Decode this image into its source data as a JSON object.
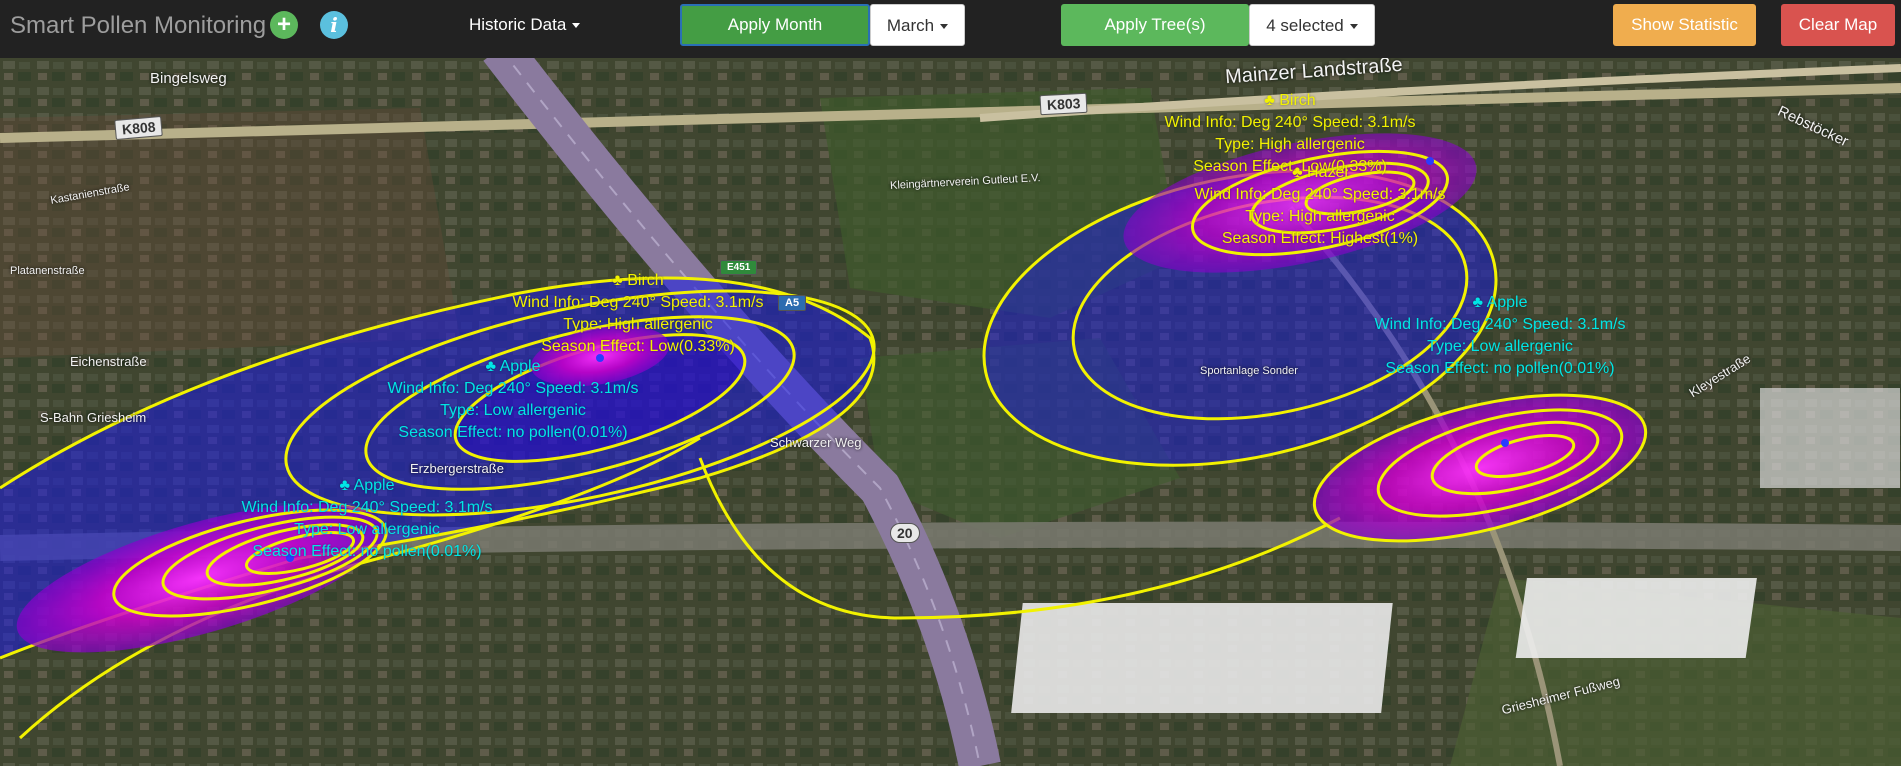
{
  "navbar": {
    "brand": "Smart Pollen Monitoring",
    "add_icon": "+",
    "info_icon": "i",
    "historic_label": "Historic Data",
    "apply_month_label": "Apply Month",
    "month_value": "March",
    "apply_trees_label": "Apply Tree(s)",
    "trees_value": "4 selected",
    "show_statistic_label": "Show Statistic",
    "clear_map_label": "Clear Map"
  },
  "colors": {
    "navbar_bg": "#222222",
    "green": "#5cb85c",
    "orange": "#f0ad4e",
    "red": "#d9534f",
    "contour": "#f2f200",
    "high_allergenic_text": "#f2f200",
    "low_allergenic_text": "#00e6e6"
  },
  "map": {
    "streets": {
      "bingelsweg": "Bingelsweg",
      "mainzer": "Mainzer Landstraße",
      "rebstoecker": "Rebstöcker",
      "eichenstrasse": "Eichenstraße",
      "erzberger": "Erzbergerstraße",
      "schwarzer": "Schwarzer Weg",
      "kleyestrasse": "Kleyestraße",
      "griesheimer": "Griesheimer Fußweg",
      "kleingarten": "Kleingärtnerverein Gutleut E.V.",
      "sportanlage": "Sportanlage Sonder",
      "sbahn": "S-Bahn Griesheim",
      "platanen": "Platanenstraße",
      "kastanien": "Kastanienstraße"
    },
    "road_signs": {
      "k808": "K808",
      "k803": "K803",
      "a5": "A5",
      "e451": "E451",
      "r20": "20"
    },
    "popups": {
      "birch_a": {
        "name": "♣ Birch",
        "wind": "Wind Info: Deg 240° Speed: 3.1m/s",
        "type": "Type: High allergenic",
        "season": "Season Effect: Low(0.33%)"
      },
      "apple_a": {
        "name": "♣ Apple",
        "wind": "Wind Info: Deg 240° Speed: 3.1m/s",
        "type": "Type: Low allergenic",
        "season": "Season Effect: no pollen(0.01%)"
      },
      "apple_b": {
        "name": "♣ Apple",
        "wind": "Wind Info: Deg 240° Speed: 3.1m/s",
        "type": "Type: Low allergenic",
        "season": "Season Effect: no pollen(0.01%)"
      },
      "birch_b": {
        "name": "♣ Birch",
        "wind": "Wind Info: Deg 240° Speed: 3.1m/s",
        "type": "Type: High allergenic",
        "season": "Season Effect: Low(0.33%)"
      },
      "hazel": {
        "name": "♣ Hazel",
        "wind": "Wind Info: Deg 240° Speed: 3.1m/s",
        "type": "Type: High allergenic",
        "season": "Season Effect: Highest(1%)"
      },
      "apple_c": {
        "name": "♣ Apple",
        "wind": "Wind Info: Deg 240° Speed: 3.1m/s",
        "type": "Type: Low allergenic",
        "season": "Season Effect: no pollen(0.01%)"
      }
    }
  }
}
